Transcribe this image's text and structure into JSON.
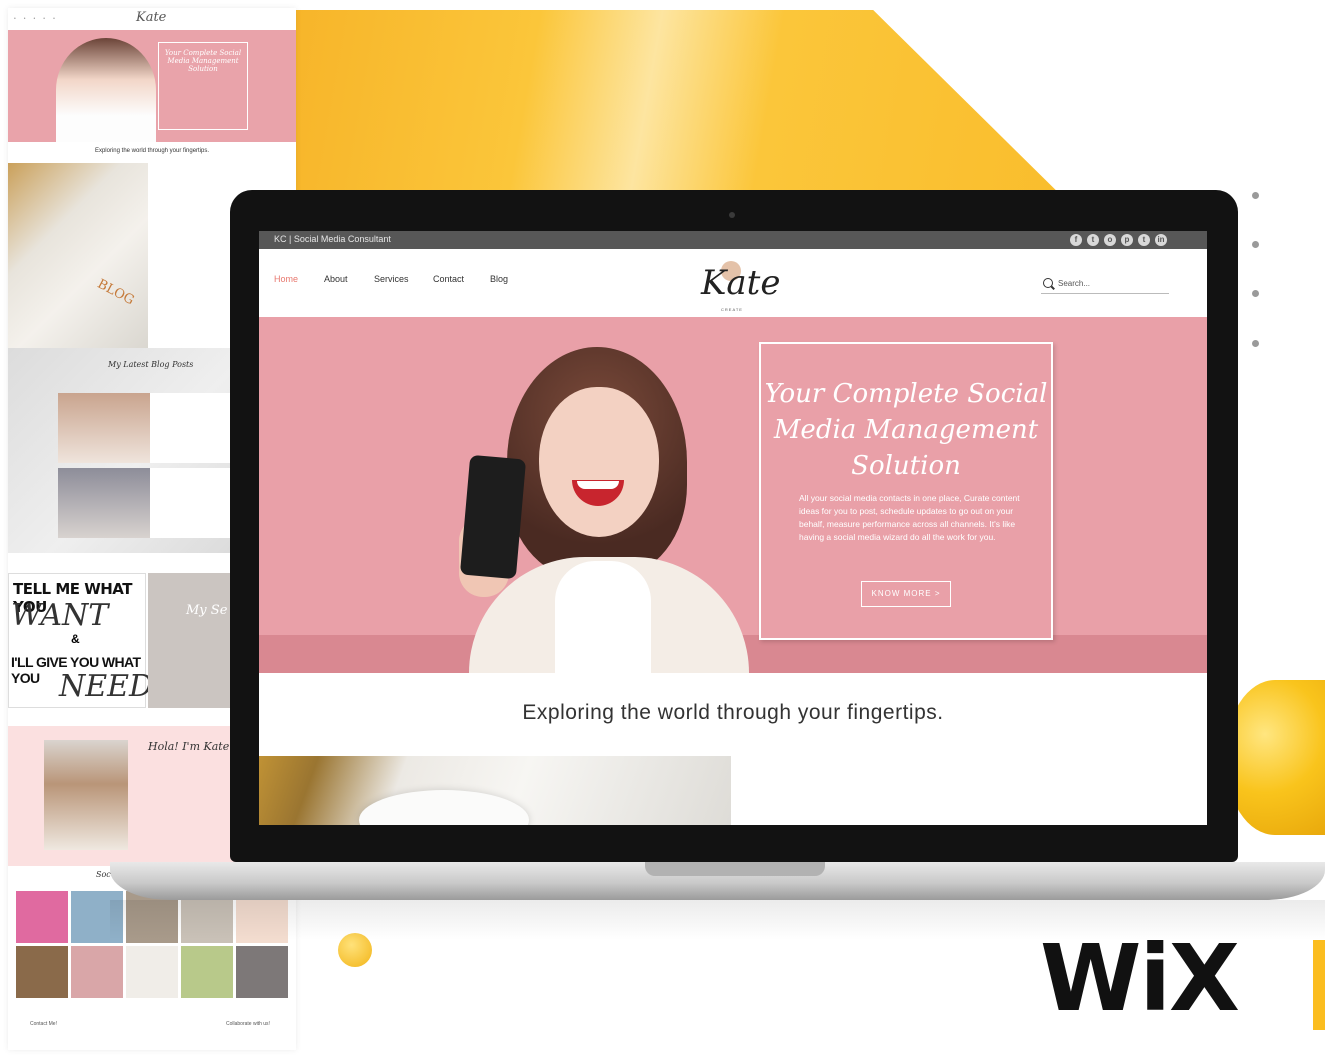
{
  "colors": {
    "accent_pink": "#e9a0a8",
    "nav_active": "#e8796f",
    "topbar": "#575757",
    "wix_yellow": "#fbbd1f"
  },
  "laptop_site": {
    "topbar": {
      "brand": "KC | Social Media Consultant",
      "social_icons": [
        "facebook-icon",
        "twitter-icon",
        "instagram-icon",
        "pinterest-icon",
        "tumblr-icon",
        "linkedin-icon"
      ]
    },
    "nav": {
      "home": "Home",
      "about": "About",
      "services": "Services",
      "contact": "Contact",
      "blog": "Blog"
    },
    "logo": {
      "word": "Kate",
      "sub": "CREATE"
    },
    "search": {
      "placeholder": "Search..."
    },
    "hero": {
      "title": "Your Complete Social Media Management Solution",
      "body": "All your social media contacts in one place, Curate content ideas for you to post, schedule updates to go out on your behalf, measure performance across all channels. It's like having a social media wizard do all the work for you.",
      "button": "KNOW MORE >"
    },
    "tagline": "Exploring the world through your fingertips."
  },
  "side_preview": {
    "hero_title": "Your Complete Social Media Management Solution",
    "tagline": "Exploring the world through your fingertips.",
    "blog_photo_text": "BLOG",
    "blog_section_title": "My Latest Blog Posts",
    "poster": {
      "line1": "TELL ME WHAT YOU",
      "line2": "WANT",
      "line3": "&",
      "line4": "I'LL GIVE YOU WHAT YOU",
      "line5": "NEED"
    },
    "services_title": "My Se",
    "about_title": "Hola! I'm Kate",
    "social_title": "Soc",
    "footer_contact": "Contact Me!",
    "footer_collab": "Collaborate with us!"
  },
  "brand_mark": "WiX"
}
